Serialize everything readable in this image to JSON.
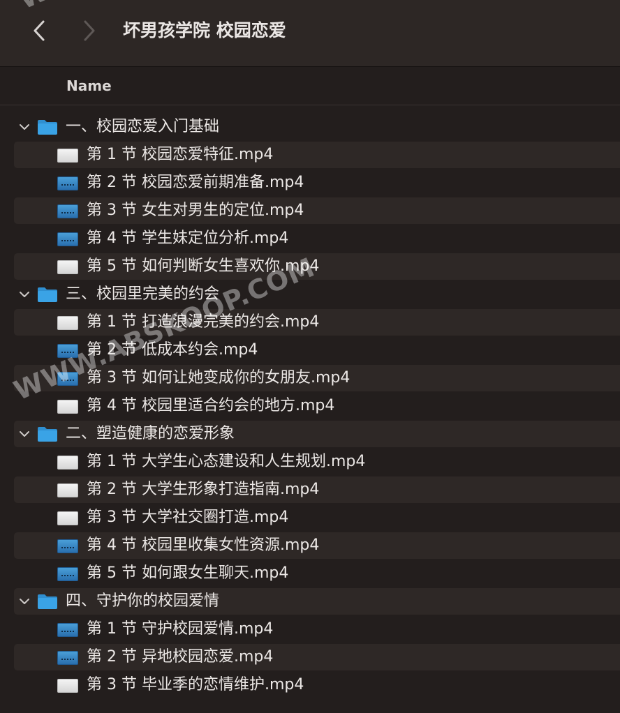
{
  "window": {
    "title": "坏男孩学院 校园恋爱"
  },
  "toolbar": {
    "back_icon": "chevron-left-icon",
    "forward_icon": "chevron-right-icon"
  },
  "columns": {
    "name": "Name"
  },
  "watermark": {
    "top": "WWW",
    "main": "WWW.ABSKOOP.COM"
  },
  "colors": {
    "background": "#231e1d",
    "stripe": "#2e2826",
    "folder_blue": "#3aa3e6",
    "text": "#ece8e6"
  },
  "rows": [
    {
      "type": "folder",
      "label": "一、校园恋爱入门基础",
      "expanded": true
    },
    {
      "type": "file",
      "label": "第 1 节  校园恋爱特征.mp4",
      "thumb": "white"
    },
    {
      "type": "file",
      "label": "第 2 节  校园恋爱前期准备.mp4",
      "thumb": "blue"
    },
    {
      "type": "file",
      "label": "第 3 节  女生对男生的定位.mp4",
      "thumb": "blue"
    },
    {
      "type": "file",
      "label": "第 4 节  学生妹定位分析.mp4",
      "thumb": "blue"
    },
    {
      "type": "file",
      "label": "第 5 节  如何判断女生喜欢你.mp4",
      "thumb": "white"
    },
    {
      "type": "folder",
      "label": "三、校园里完美的约会",
      "expanded": true
    },
    {
      "type": "file",
      "label": "第 1 节  打造浪漫完美的约会.mp4",
      "thumb": "white"
    },
    {
      "type": "file",
      "label": "第 2 节  低成本约会.mp4",
      "thumb": "blue"
    },
    {
      "type": "file",
      "label": "第 3 节  如何让她变成你的女朋友.mp4",
      "thumb": "blue"
    },
    {
      "type": "file",
      "label": "第 4 节  校园里适合约会的地方.mp4",
      "thumb": "white"
    },
    {
      "type": "folder",
      "label": "二、塑造健康的恋爱形象",
      "expanded": true
    },
    {
      "type": "file",
      "label": "第 1 节  大学生心态建设和人生规划.mp4",
      "thumb": "white"
    },
    {
      "type": "file",
      "label": "第 2 节  大学生形象打造指南.mp4",
      "thumb": "white"
    },
    {
      "type": "file",
      "label": "第 3 节  大学社交圈打造.mp4",
      "thumb": "white"
    },
    {
      "type": "file",
      "label": "第 4 节  校园里收集女性资源.mp4",
      "thumb": "blue"
    },
    {
      "type": "file",
      "label": "第 5 节  如何跟女生聊天.mp4",
      "thumb": "blue"
    },
    {
      "type": "folder",
      "label": "四、守护你的校园爱情",
      "expanded": true
    },
    {
      "type": "file",
      "label": "第 1 节  守护校园爱情.mp4",
      "thumb": "blue"
    },
    {
      "type": "file",
      "label": "第 2 节  异地校园恋爱.mp4",
      "thumb": "blue"
    },
    {
      "type": "file",
      "label": "第 3 节  毕业季的恋情维护.mp4",
      "thumb": "white"
    }
  ]
}
